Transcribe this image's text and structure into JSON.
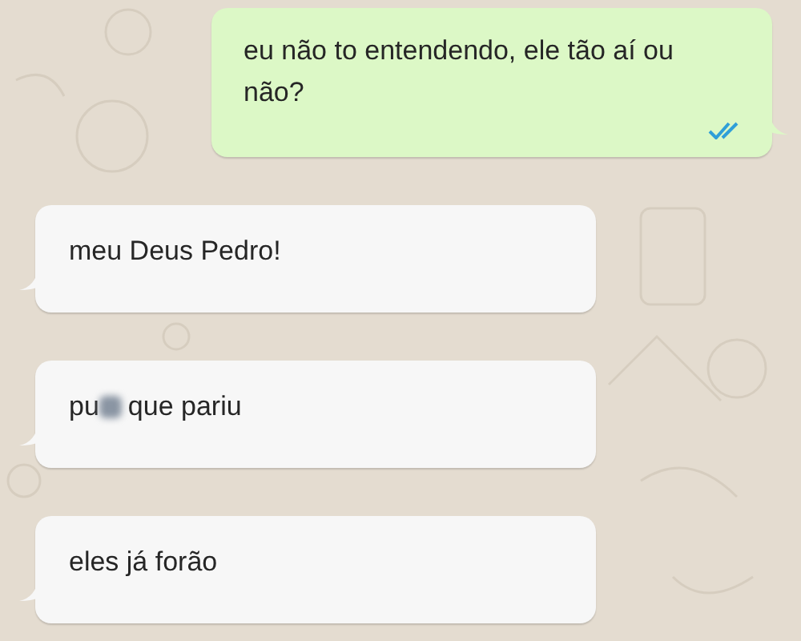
{
  "messages": [
    {
      "kind": "outgoing",
      "parts": [
        {
          "kind": "text",
          "text": "eu não to entendendo, ele tão aí ou não?"
        }
      ],
      "read": true
    },
    {
      "kind": "incoming",
      "parts": [
        {
          "kind": "text",
          "text": "meu Deus Pedro!"
        }
      ]
    },
    {
      "kind": "incoming",
      "parts": [
        {
          "kind": "text",
          "text": "pu"
        },
        {
          "kind": "blur"
        },
        {
          "kind": "text",
          "text": "que pariu"
        }
      ]
    },
    {
      "kind": "incoming",
      "parts": [
        {
          "kind": "text",
          "text": "eles já forão"
        }
      ]
    }
  ]
}
